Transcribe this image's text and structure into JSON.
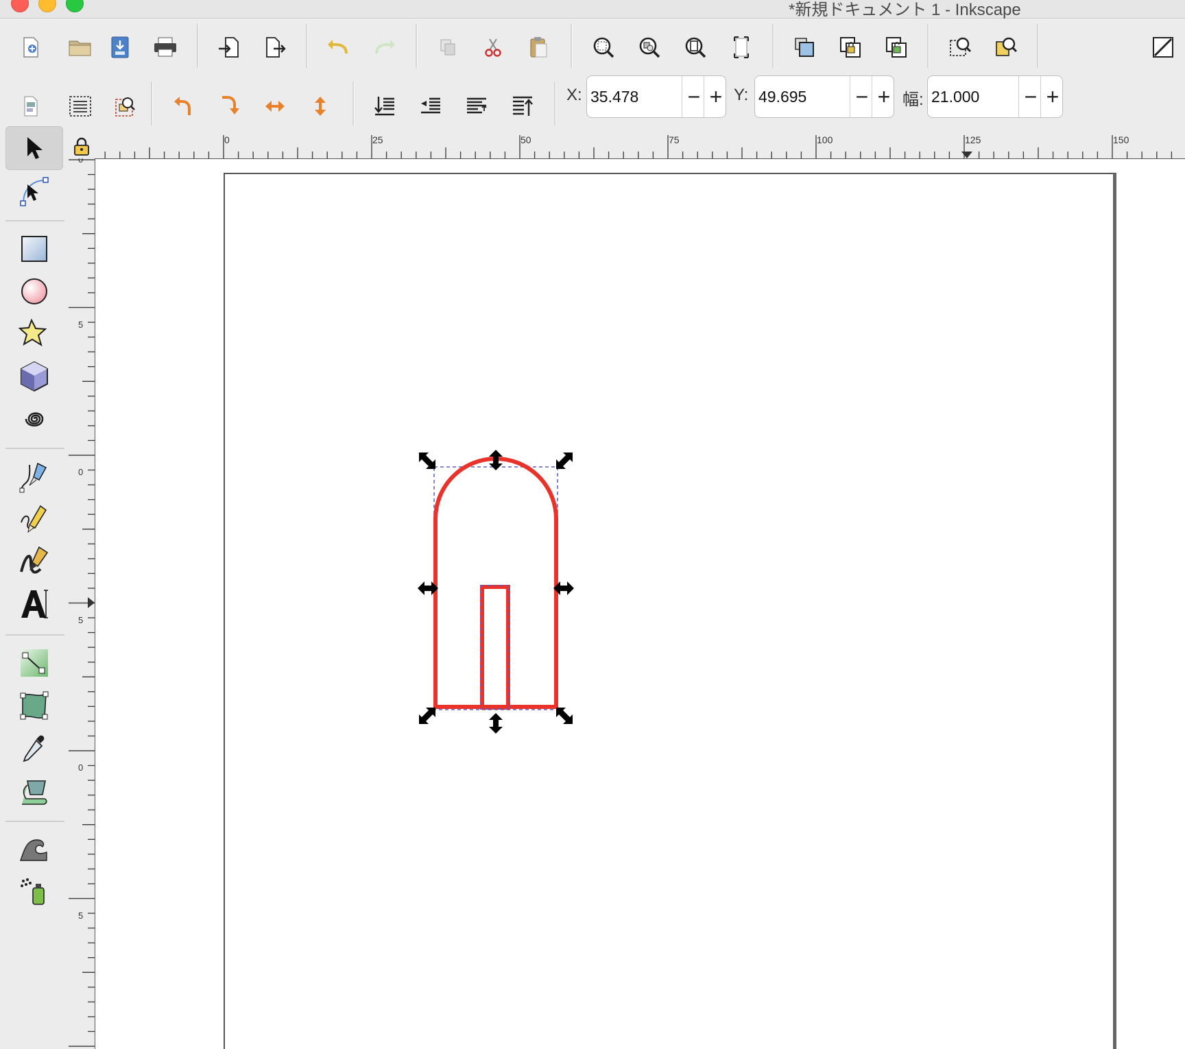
{
  "window": {
    "title": "*新規ドキュメント 1 - Inkscape"
  },
  "toolbar_commands": {
    "items": [
      "new-document",
      "open",
      "save",
      "print",
      "import",
      "export",
      "undo",
      "redo",
      "duplicate",
      "cut",
      "paste",
      "zoom-selection",
      "zoom-drawing",
      "zoom-page",
      "zoom-page-width",
      "group",
      "ungroup",
      "unlock",
      "fill-stroke",
      "align-distribute"
    ]
  },
  "toolbar_controls": {
    "x_label": "X:",
    "x_value": "35.478",
    "y_label": "Y:",
    "y_value": "49.695",
    "w_label": "幅:",
    "w_value": "21.000",
    "minus": "−",
    "plus": "+"
  },
  "toolbox": {
    "tools": [
      "selector",
      "node",
      "rectangle",
      "ellipse",
      "star",
      "3d-box",
      "spiral",
      "bezier-pen",
      "pencil",
      "calligraphy",
      "text",
      "connector",
      "mesh-gradient",
      "dropper",
      "paint-bucket",
      "tweak",
      "spray"
    ],
    "active": "selector"
  },
  "rulers": {
    "horizontal_labels": [
      "0",
      "25",
      "50",
      "75",
      "100",
      "125",
      "150"
    ],
    "vertical_labels": [
      "0",
      "5",
      "0",
      "5",
      "0",
      "5"
    ]
  },
  "colors": {
    "shape_stroke": "#e8322a",
    "bbox_dash": "#5c5cc8",
    "page_border": "#555555"
  }
}
